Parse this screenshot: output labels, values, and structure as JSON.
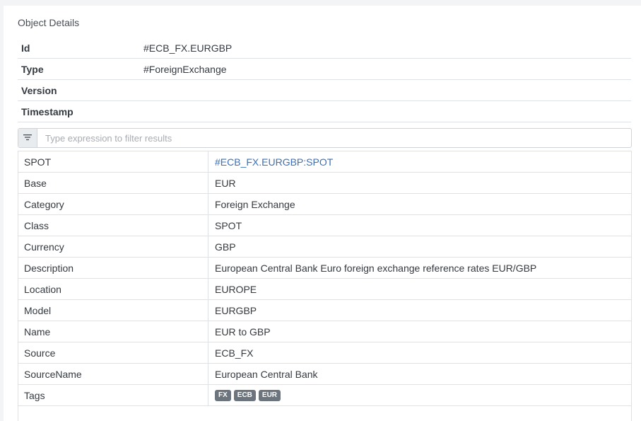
{
  "section_title": "Object Details",
  "meta": [
    {
      "key": "Id",
      "value": "#ECB_FX.EURGBP"
    },
    {
      "key": "Type",
      "value": "#ForeignExchange"
    },
    {
      "key": "Version",
      "value": ""
    },
    {
      "key": "Timestamp",
      "value": ""
    }
  ],
  "filter": {
    "placeholder": "Type expression to filter results",
    "icon": "filter-icon"
  },
  "properties": [
    {
      "key": "SPOT",
      "value": "#ECB_FX.EURGBP:SPOT"
    },
    {
      "key": "Base",
      "value": "EUR"
    },
    {
      "key": "Category",
      "value": "Foreign Exchange"
    },
    {
      "key": "Class",
      "value": "SPOT"
    },
    {
      "key": "Currency",
      "value": "GBP"
    },
    {
      "key": "Description",
      "value": "European Central Bank Euro foreign exchange reference rates EUR/GBP"
    },
    {
      "key": "Location",
      "value": "EUROPE"
    },
    {
      "key": "Model",
      "value": "EURGBP"
    },
    {
      "key": "Name",
      "value": "EUR to GBP"
    },
    {
      "key": "Source",
      "value": "ECB_FX"
    },
    {
      "key": "SourceName",
      "value": "European Central Bank"
    },
    {
      "key": "Tags",
      "tags": [
        "FX",
        "ECB",
        "EUR"
      ]
    }
  ],
  "colors": {
    "link": "#3b6fb6",
    "tag_bg": "#6c757d",
    "border": "#dee2e6"
  }
}
